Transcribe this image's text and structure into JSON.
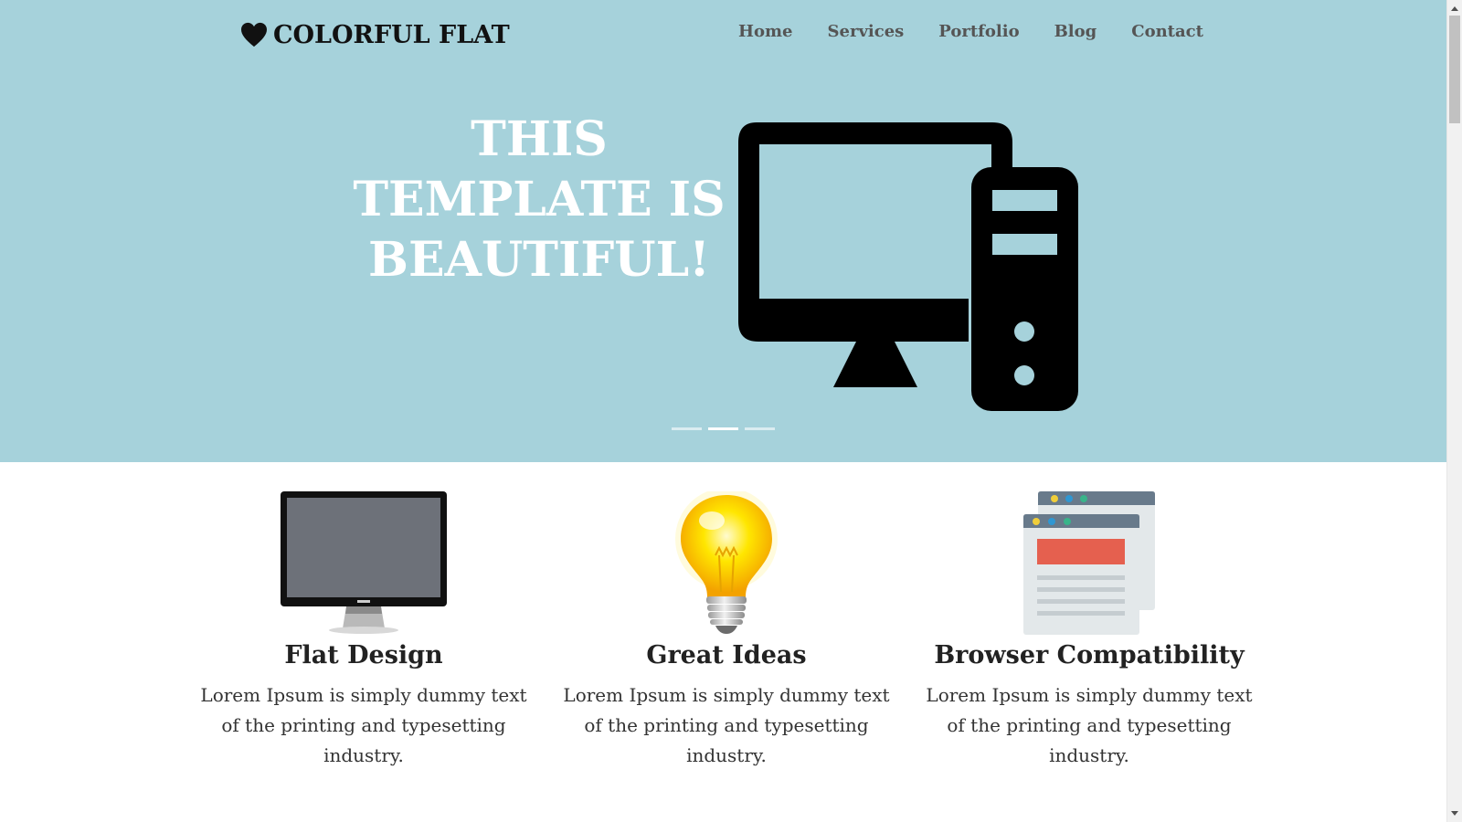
{
  "brand": {
    "name": "COLORFUL FLAT",
    "icon": "heart-icon"
  },
  "nav": {
    "items": [
      {
        "label": "Home"
      },
      {
        "label": "Services"
      },
      {
        "label": "Portfolio"
      },
      {
        "label": "Blog"
      },
      {
        "label": "Contact"
      }
    ]
  },
  "hero": {
    "headline": "THIS\nTEMPLATE IS\nBEAUTIFUL!",
    "icon": "desktop-computer-icon",
    "slides_count": 3,
    "active_slide": 2,
    "background_color": "#a6d2db"
  },
  "features": [
    {
      "title": "Flat Design",
      "text": "Lorem Ipsum is simply dummy text of the printing and typesetting industry.",
      "icon": "monitor-icon"
    },
    {
      "title": "Great Ideas",
      "text": "Lorem Ipsum is simply dummy text of the printing and typesetting industry.",
      "icon": "lightbulb-icon"
    },
    {
      "title": "Browser Compatibility",
      "text": "Lorem Ipsum is simply dummy text of the printing and typesetting industry.",
      "icon": "browser-windows-icon"
    }
  ]
}
